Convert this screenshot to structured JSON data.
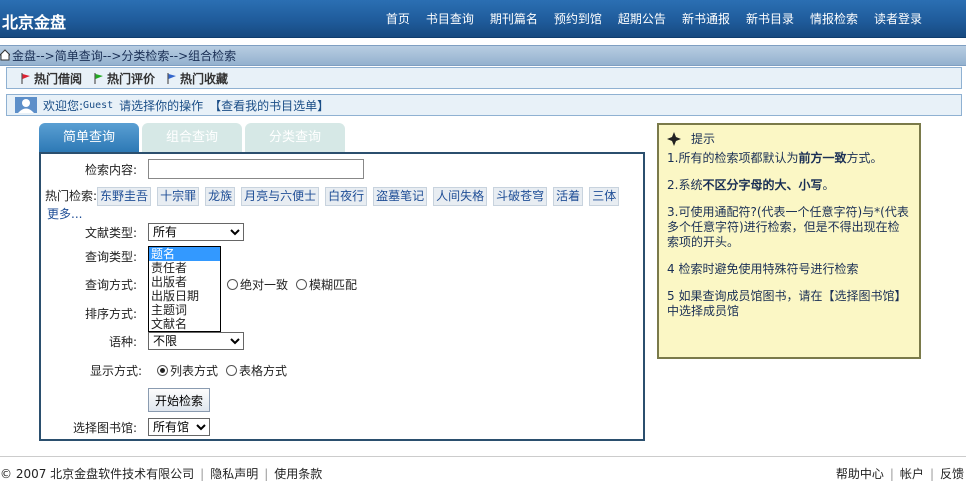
{
  "header": {
    "logo": "北京金盘",
    "nav": [
      "首页",
      "书目查询",
      "期刊篇名",
      "预约到馆",
      "超期公告",
      "新书通报",
      "新书目录",
      "情报检索",
      "读者登录"
    ]
  },
  "breadcrumb": "金盘-->简单查询-->分类检索-->组合检索",
  "quick_links": [
    "热门借阅",
    "热门评价",
    "热门收藏"
  ],
  "welcome": {
    "prefix": "欢迎您:",
    "user": "Guest",
    "message": "请选择你的操作",
    "link": "【查看我的书目选单】"
  },
  "tabs": [
    "简单查询",
    "组合查询",
    "分类查询"
  ],
  "form": {
    "search_label": "检索内容:",
    "search_value": "",
    "hot_label": "热门检索:",
    "hot_keywords": [
      "东野圭吾",
      "十宗罪",
      "龙族",
      "月亮与六便士",
      "白夜行",
      "盗墓笔记",
      "人间失格",
      "斗破苍穹",
      "活着",
      "三体"
    ],
    "more": "更多...",
    "doctype_label": "文献类型:",
    "doctype_value": "所有",
    "querytype_label": "查询类型:",
    "querytype_options": [
      "题名",
      "责任者",
      "出版者",
      "出版日期",
      "主题词",
      "文献名"
    ],
    "querymode_label": "查询方式:",
    "querymode_options": [
      "绝对一致",
      "模糊匹配"
    ],
    "sort_label": "排序方式:",
    "lang_label": "语种:",
    "lang_value": "不限",
    "display_label": "显示方式:",
    "display_options": [
      "列表方式",
      "表格方式"
    ],
    "submit": "开始检索",
    "library_label": "选择图书馆:",
    "library_value": "所有馆"
  },
  "tips": {
    "title": "提示",
    "items": [
      {
        "pre": "1.所有的检索项都默认为",
        "bold": "前方一致",
        "post": "方式。"
      },
      {
        "pre": "2.系统",
        "bold": "不区分字母的大、小写",
        "post": "。"
      },
      {
        "pre": "3.可使用通配符?(代表一个任意字符)与*(代表多个任意字符)进行检索，但是不得出现在检索项的开头。",
        "bold": "",
        "post": ""
      },
      {
        "pre": "4 检索时避免使用特殊符号进行检索",
        "bold": "",
        "post": ""
      },
      {
        "pre": "5 如果查询成员馆图书，请在【选择图书馆】中选择成员馆",
        "bold": "",
        "post": ""
      }
    ]
  },
  "footer": {
    "copyright": "© 2007 北京金盘软件技术有限公司",
    "privacy": "隐私声明",
    "terms": "使用条款",
    "help": "帮助中心",
    "account": "帐户",
    "feedback": "反馈"
  },
  "colors": {
    "header": "#1e5a99",
    "tab_active": "#2d79b5",
    "tips_bg": "#fbf7c5"
  }
}
